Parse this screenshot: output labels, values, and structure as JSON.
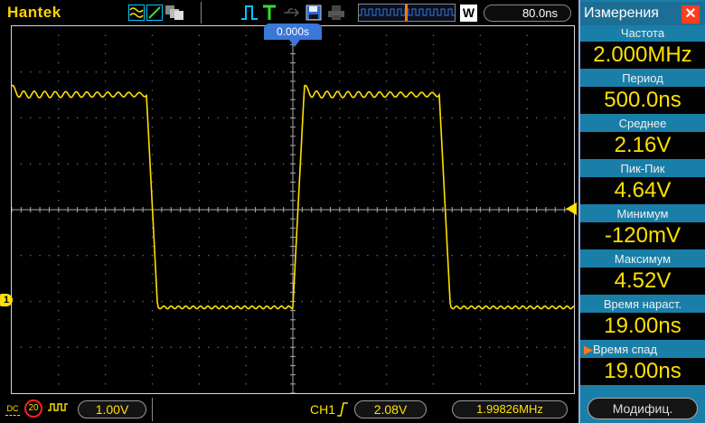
{
  "topbar": {
    "brand": "Hantek",
    "w_badge": "W",
    "timebase": "80.0ns"
  },
  "screen": {
    "trigger_position": "0.000s",
    "ch1_marker": "1"
  },
  "panel": {
    "title": "Измерения",
    "close": "✕",
    "measurements": [
      {
        "label": "Частота",
        "value": "2.000MHz"
      },
      {
        "label": "Период",
        "value": "500.0ns"
      },
      {
        "label": "Среднее",
        "value": "2.16V"
      },
      {
        "label": "Пик-Пик",
        "value": "4.64V"
      },
      {
        "label": "Минимум",
        "value": "-120mV"
      },
      {
        "label": "Максимум",
        "value": "4.52V"
      },
      {
        "label": "Время нараст.",
        "value": "19.00ns"
      },
      {
        "label": "Время спад",
        "value": "19.00ns",
        "selected": true
      }
    ],
    "modify_button": "Модифиц."
  },
  "bottombar": {
    "coupling": "DC",
    "bw_limit": "20",
    "volts_per_div": "1.00V",
    "trigger_channel": "CH1",
    "trigger_level": "2.08V",
    "frequency_counter": "1.99826MHz"
  },
  "colors": {
    "trace": "#ffe000",
    "panel": "#1a7fa8",
    "brand": "#ffd200",
    "trigger_marker": "#3a78d8"
  }
}
